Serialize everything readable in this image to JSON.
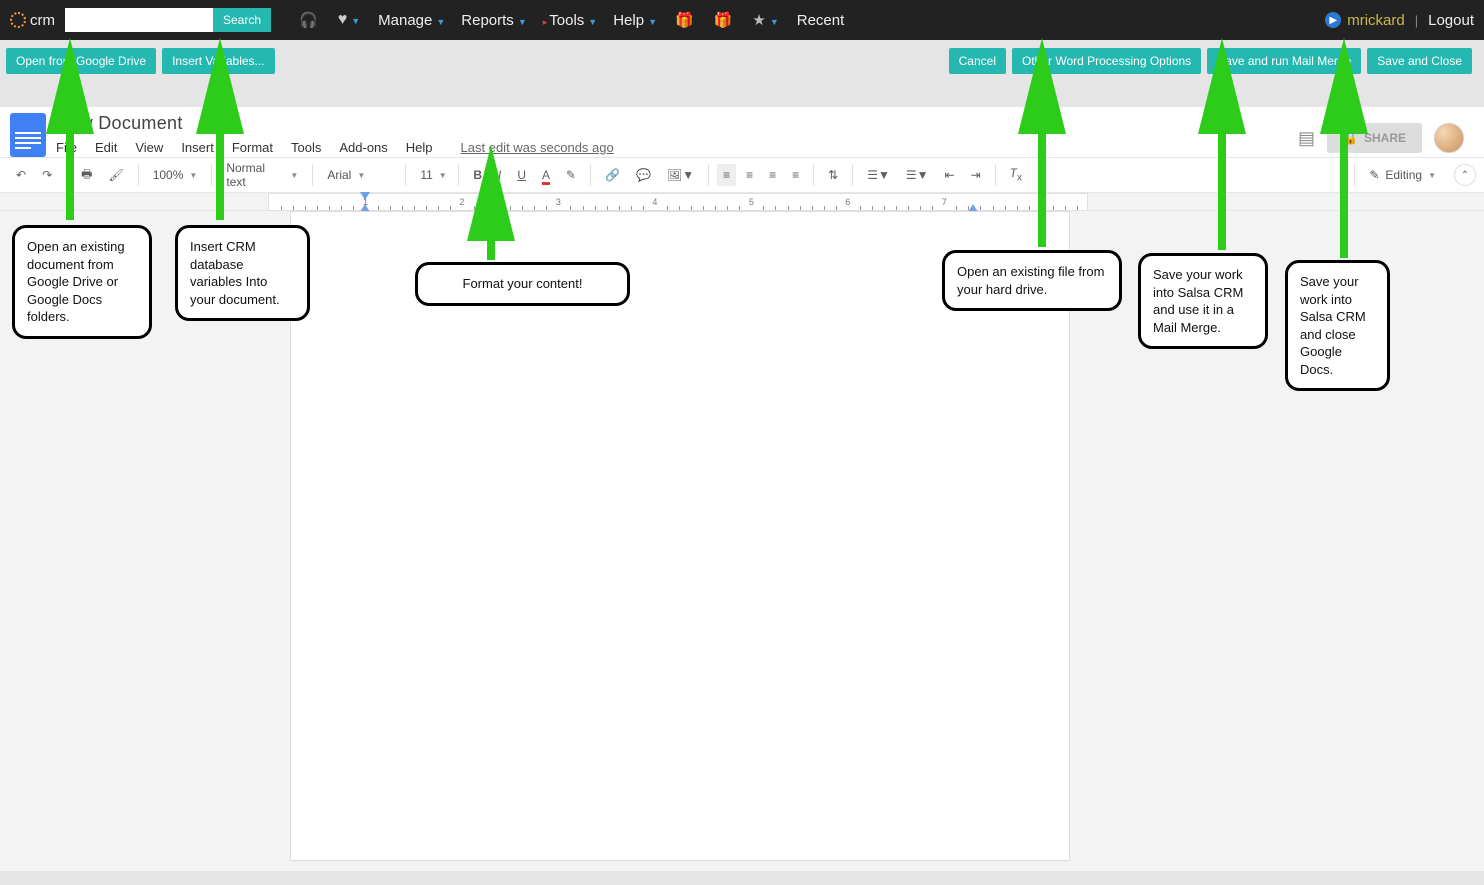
{
  "crm": {
    "brand": "crm",
    "search_button": "Search",
    "menus": [
      "Manage",
      "Reports",
      "Tools",
      "Help"
    ],
    "recent": "Recent",
    "username": "mrickard",
    "logout": "Logout"
  },
  "actions": {
    "left": [
      "Open from Google Drive",
      "Insert Variables..."
    ],
    "right": [
      "Cancel",
      "Other Word Processing Options",
      "Save and run Mail Merge",
      "Save and Close"
    ]
  },
  "doc": {
    "title": "New Document",
    "menus": [
      "File",
      "Edit",
      "View",
      "Insert",
      "Format",
      "Tools",
      "Add-ons",
      "Help"
    ],
    "last_edit": "Last edit was seconds ago",
    "share": "SHARE",
    "mode": "Editing"
  },
  "toolbar": {
    "zoom": "100%",
    "style": "Normal text",
    "font": "Arial",
    "size": "11"
  },
  "ruler": {
    "numbers": [
      1,
      2,
      3,
      4,
      5,
      6,
      7
    ]
  },
  "annotations": {
    "open_drive": "Open an existing document from Google Drive or Google Docs folders.",
    "insert_vars": "Insert CRM database variables Into your document.",
    "format": "Format your content!",
    "open_file": "Open an existing file from your hard drive.",
    "mail_merge": "Save your work into Salsa CRM and use it in a Mail Merge.",
    "save_close": "Save your work into Salsa CRM and close Google Docs."
  }
}
